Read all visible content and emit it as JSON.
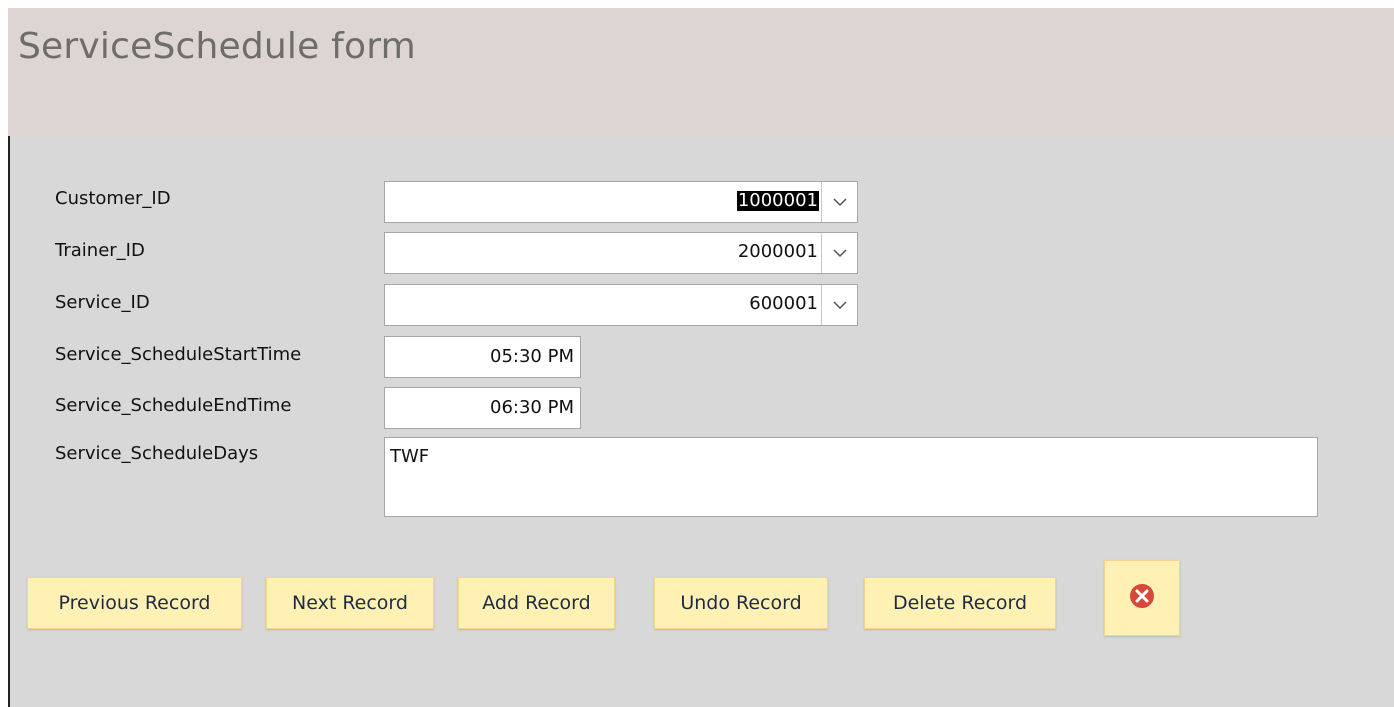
{
  "form": {
    "title": "ServiceSchedule form"
  },
  "fields": {
    "customer_id": {
      "label": "Customer_ID",
      "value": "1000001"
    },
    "trainer_id": {
      "label": "Trainer_ID",
      "value": "2000001"
    },
    "service_id": {
      "label": "Service_ID",
      "value": "600001"
    },
    "start_time": {
      "label": "Service_ScheduleStartTime",
      "value": "05:30 PM"
    },
    "end_time": {
      "label": "Service_ScheduleEndTime",
      "value": "06:30 PM"
    },
    "days": {
      "label": "Service_ScheduleDays",
      "value": "TWF"
    }
  },
  "buttons": {
    "previous": "Previous Record",
    "next": "Next Record",
    "add": "Add Record",
    "undo": "Undo Record",
    "delete": "Delete Record",
    "close_icon": "close-circle-icon"
  },
  "colors": {
    "header_bg": "#ddd5d1",
    "detail_bg": "#d8d8d8",
    "button_bg": "#fff1b3",
    "close_icon": "#d9473b"
  }
}
